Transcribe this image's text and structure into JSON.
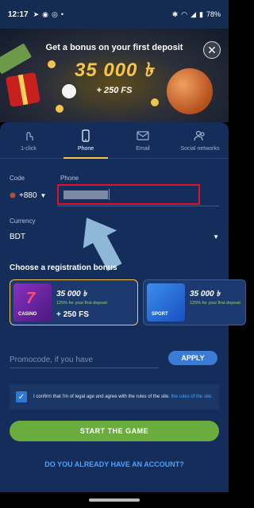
{
  "status_bar": {
    "time": "12:17",
    "battery": "78%"
  },
  "banner": {
    "title": "Get a bonus on your first deposit",
    "amount": "35 000 ৳",
    "free_spins": "+ 250 FS"
  },
  "tabs": [
    {
      "label": "1-click",
      "icon": "tap-icon",
      "active": false
    },
    {
      "label": "Phone",
      "icon": "phone-icon",
      "active": true
    },
    {
      "label": "Email",
      "icon": "email-icon",
      "active": false
    },
    {
      "label": "Social networks",
      "icon": "people-icon",
      "active": false
    }
  ],
  "form": {
    "code_label": "Code",
    "code_value": "+880",
    "phone_label": "Phone",
    "currency_label": "Currency",
    "currency_value": "BDT"
  },
  "bonus": {
    "title": "Choose a registration bonus",
    "cards": [
      {
        "thumb_label": "CASINO",
        "amount": "35 000 ৳",
        "desc": "125% for your first deposit",
        "fs": "+ 250 FS",
        "selected": true
      },
      {
        "thumb_label": "SPORT",
        "amount": "35 000 ৳",
        "desc": "125% for your first deposit",
        "selected": false
      }
    ]
  },
  "promo": {
    "placeholder": "Promocode, if you have",
    "apply_label": "APPLY"
  },
  "agreement": {
    "text": "I confirm that I'm of legal age and agree with the rules of the site. ",
    "link": "the rules of the site.",
    "checked": true
  },
  "start_button": "START THE GAME",
  "login_link": "DO YOU ALREADY HAVE AN ACCOUNT?",
  "colors": {
    "panel": "#152d5a",
    "accent": "#f8c64a",
    "start": "#6aac3e",
    "link": "#4aa3ff",
    "highlight": "#e0122a"
  }
}
